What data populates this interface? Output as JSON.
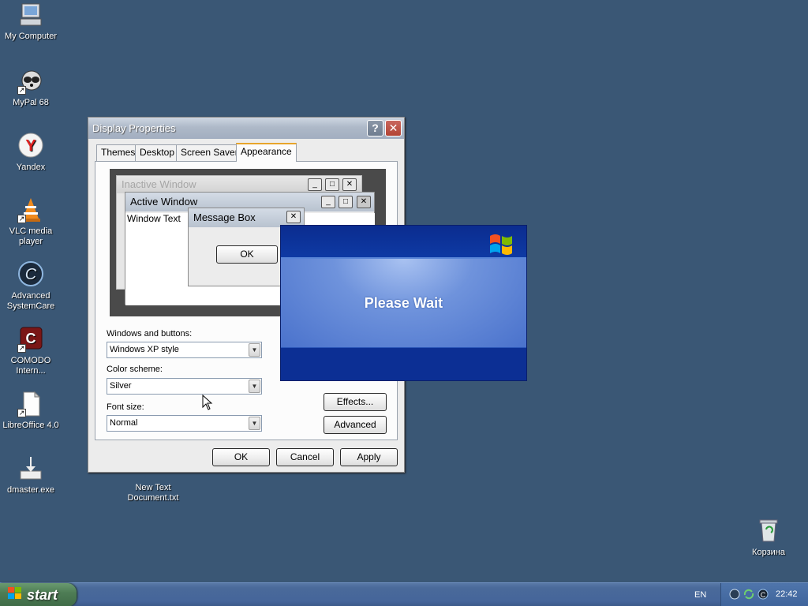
{
  "desktop": {
    "icons": [
      {
        "label": "My Computer"
      },
      {
        "label": "MyPal 68"
      },
      {
        "label": "Yandex"
      },
      {
        "label": "VLC media player"
      },
      {
        "label": "Advanced SystemCare"
      },
      {
        "label": "COMODO Intern..."
      },
      {
        "label": "LibreOffice 4.0"
      },
      {
        "label": "dmaster.exe"
      },
      {
        "label": "New Text Document.txt"
      },
      {
        "label": "Корзина"
      }
    ]
  },
  "dialog": {
    "title": "Display Properties",
    "help_glyph": "?",
    "close_glyph": "✕",
    "tabs": [
      "Themes",
      "Desktop",
      "Screen Saver",
      "Appearance"
    ],
    "active_tab": "Appearance",
    "preview": {
      "inactive_title": "Inactive Window",
      "active_title": "Active Window",
      "window_text": "Window Text",
      "message_box_title": "Message Box",
      "ok_label": "OK"
    },
    "windows_buttons_label": "Windows and buttons:",
    "windows_buttons_value": "Windows XP style",
    "color_scheme_label": "Color scheme:",
    "color_scheme_value": "Silver",
    "font_size_label": "Font size:",
    "font_size_value": "Normal",
    "effects_label": "Effects...",
    "advanced_label": "Advanced",
    "ok_label": "OK",
    "cancel_label": "Cancel",
    "apply_label": "Apply"
  },
  "splash": {
    "message": "Please Wait"
  },
  "taskbar": {
    "start_label": "start",
    "language": "EN",
    "clock": "22:42"
  },
  "colors": {
    "desktop": "#3a5775",
    "taskbar": "#45659a",
    "start": "#4e7d55",
    "splash": "#0c2f94"
  }
}
